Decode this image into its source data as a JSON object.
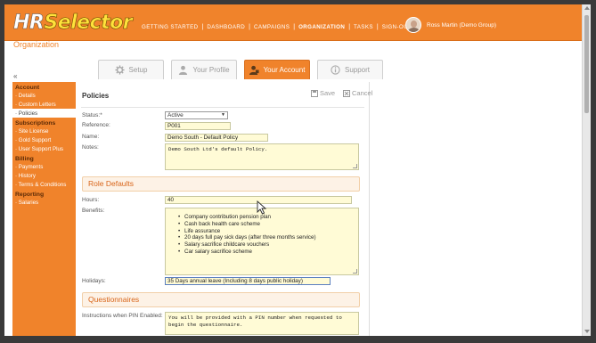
{
  "app": {
    "logo_hr": "HR",
    "logo_selector": "Selector",
    "subtitle": "Organization"
  },
  "nav": {
    "items": [
      "GETTING STARTED",
      "DASHBOARD",
      "CAMPAIGNS",
      "ORGANIZATION",
      "TASKS",
      "SIGN-OUT"
    ],
    "active": "ORGANIZATION",
    "separator": "|"
  },
  "user": {
    "name": "Ross Martin (Demo Group)"
  },
  "tabs": [
    {
      "label": "Setup",
      "icon": "gear-icon"
    },
    {
      "label": "Your Profile",
      "icon": "person-icon"
    },
    {
      "label": "Your Account",
      "icon": "account-icon",
      "active": true
    },
    {
      "label": "Support",
      "icon": "info-icon"
    }
  ],
  "collapse": "«",
  "sidebar": {
    "account": {
      "title": "Account",
      "items": [
        "· Details",
        "· Custom Letters",
        "· Policies"
      ]
    },
    "subscriptions": {
      "title": "Subscriptions",
      "items": [
        "· Site License",
        "· Gold Support",
        "· User Support Plus"
      ]
    },
    "billing": {
      "title": "Billing",
      "items": [
        "· Payments",
        "· History",
        "· Terms & Conditions"
      ]
    },
    "reporting": {
      "title": "Reporting",
      "items": [
        "· Salaries"
      ]
    },
    "active_item": "· Policies"
  },
  "main": {
    "title": "Policies",
    "save_label": "Save",
    "cancel_label": "Cancel",
    "status": {
      "label": "Status:*",
      "value": "Active"
    },
    "reference": {
      "label": "Reference:",
      "value": "P001"
    },
    "name": {
      "label": "Name:",
      "value": "Demo South - Default Policy"
    },
    "notes": {
      "label": "Notes:",
      "value": "Demo South Ltd's default Policy."
    },
    "role_defaults": {
      "header": "Role Defaults",
      "hours": {
        "label": "Hours:",
        "value": "40"
      },
      "benefits": {
        "label": "Benefits:",
        "items": [
          "Company contribution pension plan",
          "Cash back health care scheme",
          "Life assurance",
          "20 days full pay sick days (after three months service)",
          "Salary sacrifice childcare vouchers",
          "Car salary sacrifice scheme"
        ]
      },
      "holidays": {
        "label": "Holidays:",
        "value": "35 Days annual leave (Including 8 days public holiday)"
      }
    },
    "questionnaires": {
      "header": "Questionnaires",
      "pin_instructions": {
        "label": "Instructions when PIN Enabled:",
        "value": "You will be provided with a PIN number when requested to begin the questionnaire."
      }
    }
  },
  "colors": {
    "brand_orange": "#f0832b",
    "logo_yellow": "#ffe23b",
    "field_yellow": "#fffbd6",
    "section_text": "#d8651a"
  }
}
